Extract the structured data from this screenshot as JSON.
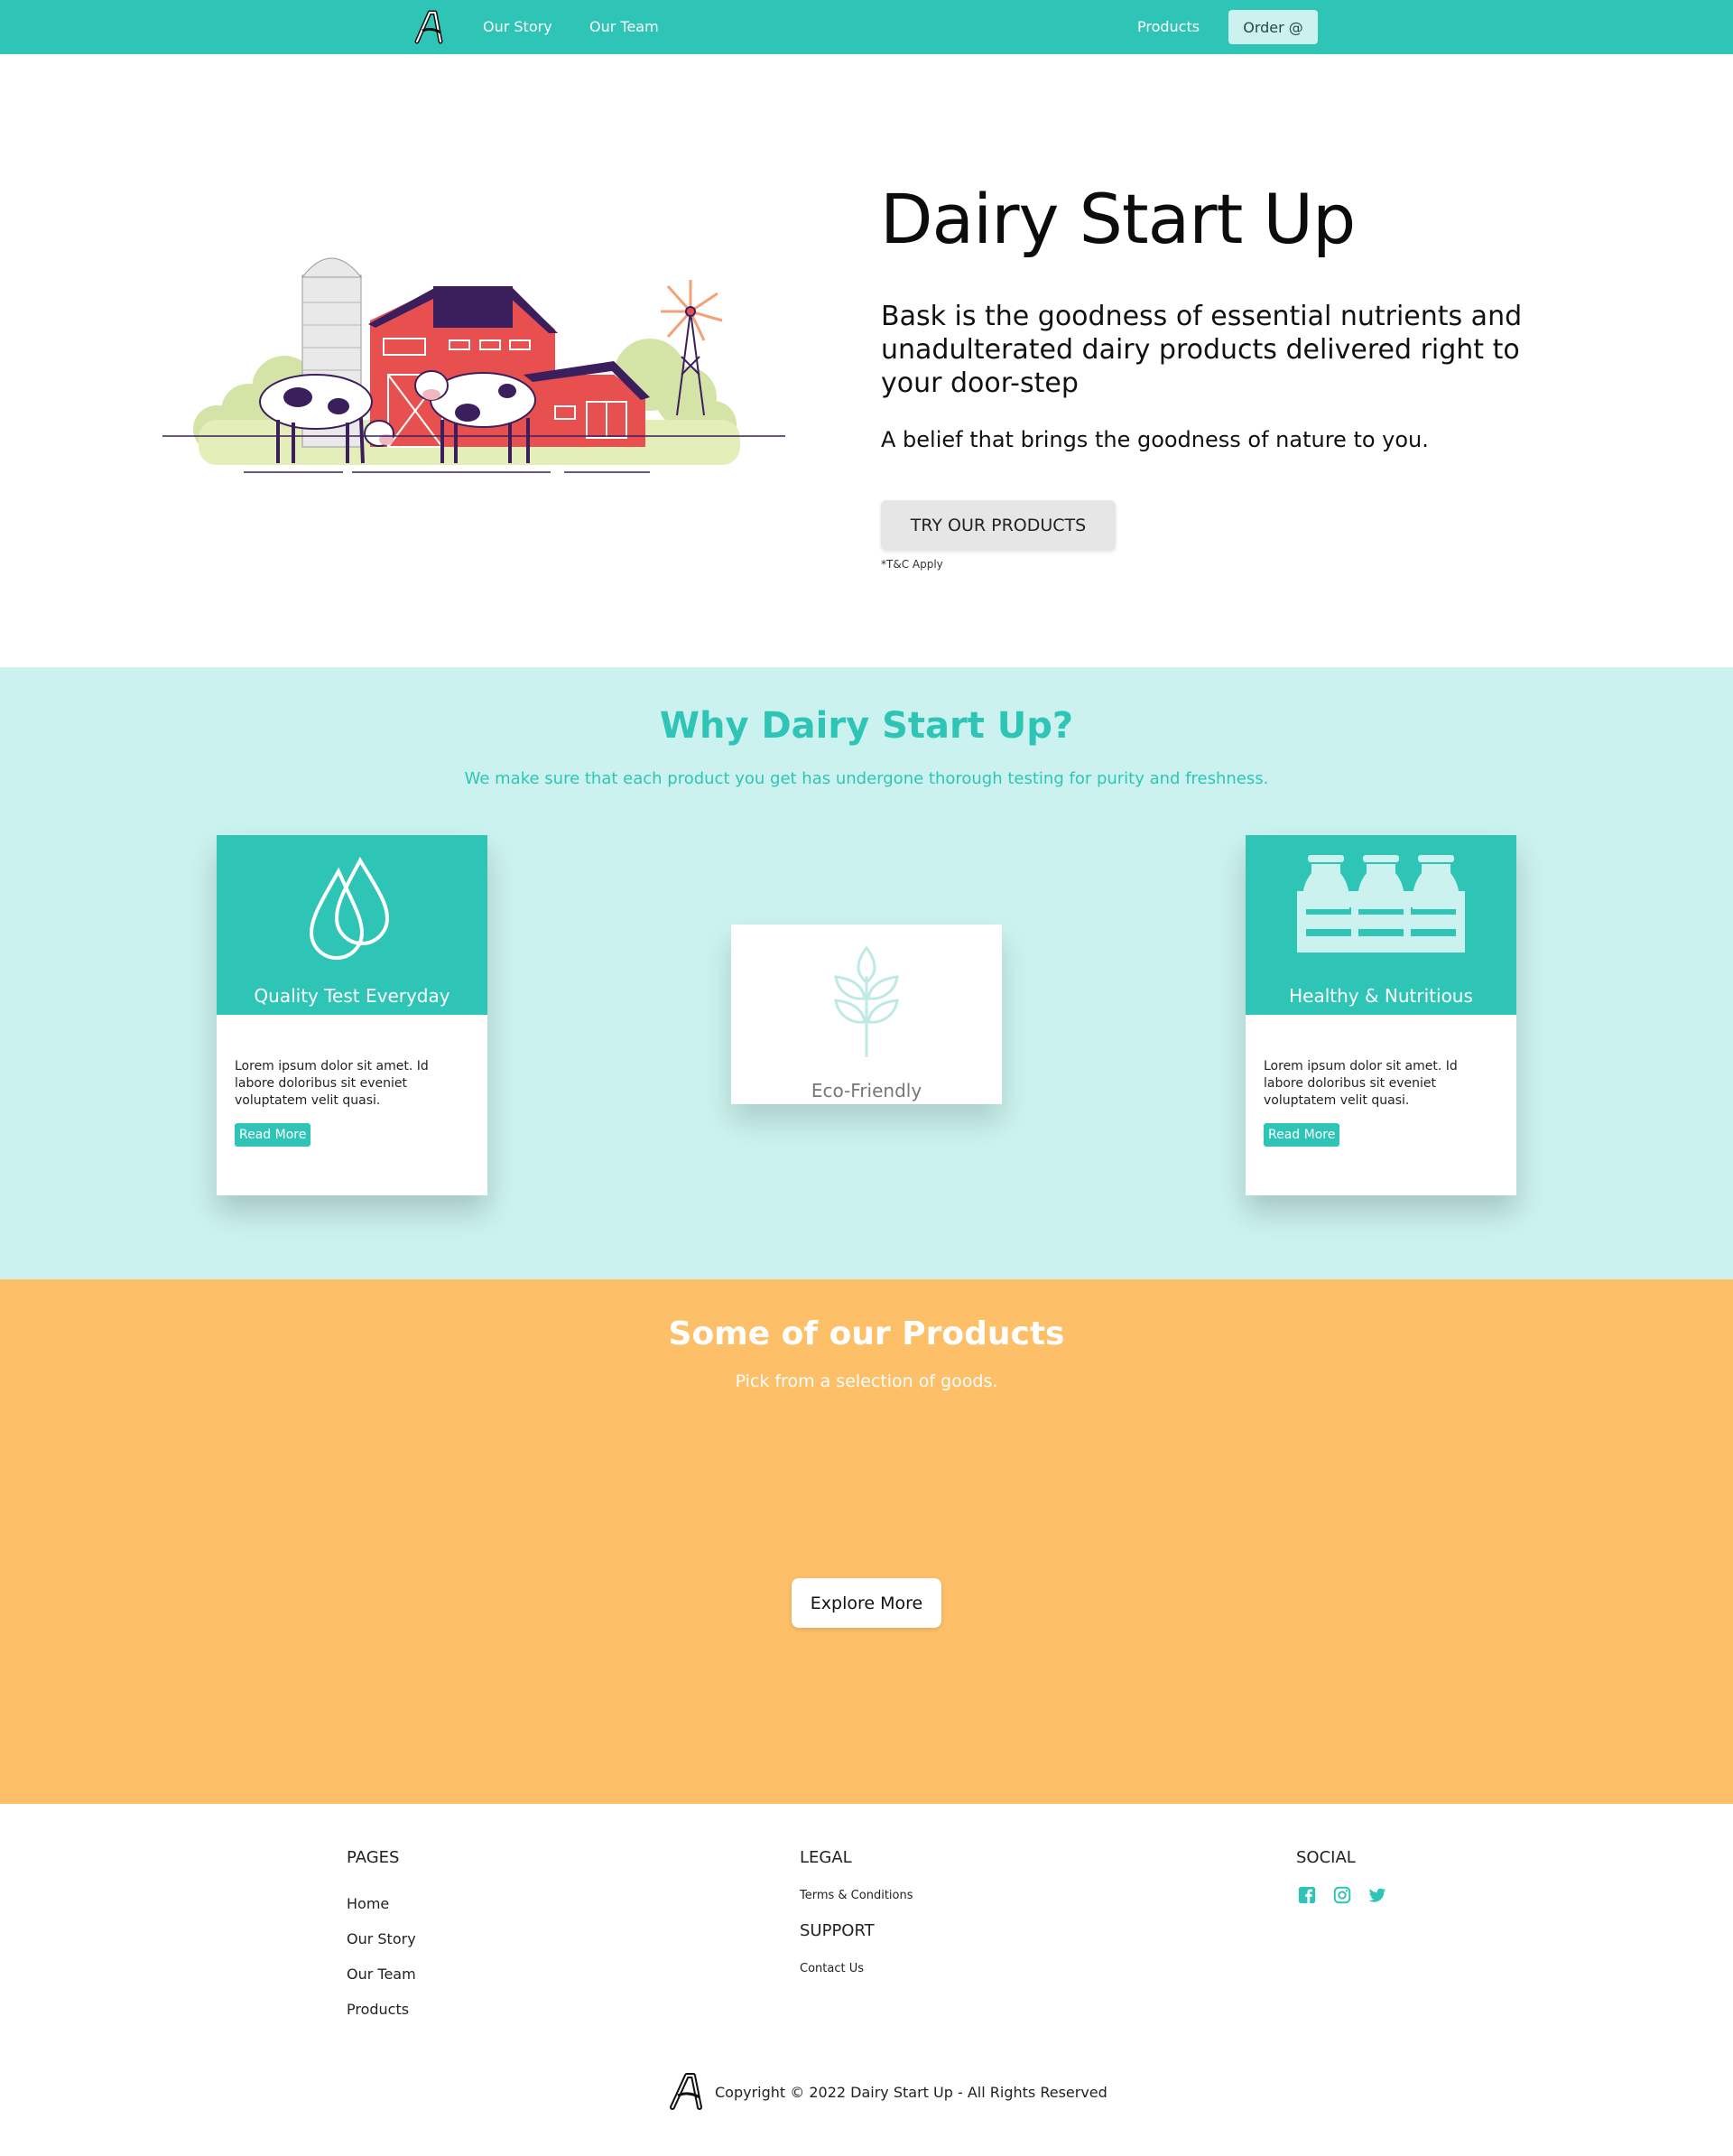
{
  "nav": {
    "links": [
      "Our Story",
      "Our Team",
      "Products"
    ],
    "order_label": "Order @"
  },
  "hero": {
    "title": "Dairy Start Up",
    "description": "Bask is the goodness of essential nutrients and unadulterated dairy products delivered right to your door-step",
    "belief": "A belief that brings the goodness of nature to you.",
    "cta_label": "TRY OUR PRODUCTS",
    "tc_note": "*T&C Apply"
  },
  "why": {
    "title": "Why Dairy Start Up?",
    "subtitle": "We make sure that each product you get has undergone thorough testing for purity and freshness.",
    "cards": [
      {
        "label": "Quality Test Everyday",
        "text": "Lorem ipsum dolor sit amet. Id labore doloribus sit eveniet voluptatem velit quasi.",
        "more": "Read More",
        "icon": "water-drops-icon"
      },
      {
        "label": "Eco-Friendly",
        "icon": "wheat-icon"
      },
      {
        "label": "Healthy & Nutritious",
        "text": "Lorem ipsum dolor sit amet. Id labore doloribus sit eveniet voluptatem velit quasi.",
        "more": "Read More",
        "icon": "milk-crate-icon"
      }
    ]
  },
  "products": {
    "title": "Some of our Products",
    "subtitle": "Pick from a selection of goods.",
    "explore_label": "Explore More"
  },
  "footer": {
    "pages_heading": "PAGES",
    "pages": [
      "Home",
      "Our Story",
      "Our Team",
      "Products"
    ],
    "legal_heading": "LEGAL",
    "legal_link": "Terms & Conditions",
    "support_heading": "SUPPORT",
    "support_link": "Contact Us",
    "social_heading": "SOCIAL",
    "social_icons": [
      "facebook-icon",
      "instagram-icon",
      "twitter-icon"
    ],
    "copyright": "Copyright © 2022 Dairy Start Up - All Rights Reserved"
  },
  "colors": {
    "teal": "#2ec5b6",
    "light_teal": "#cbf2ee",
    "orange": "#febf69",
    "barn_red": "#e8504f",
    "purple": "#3b1f5c"
  }
}
